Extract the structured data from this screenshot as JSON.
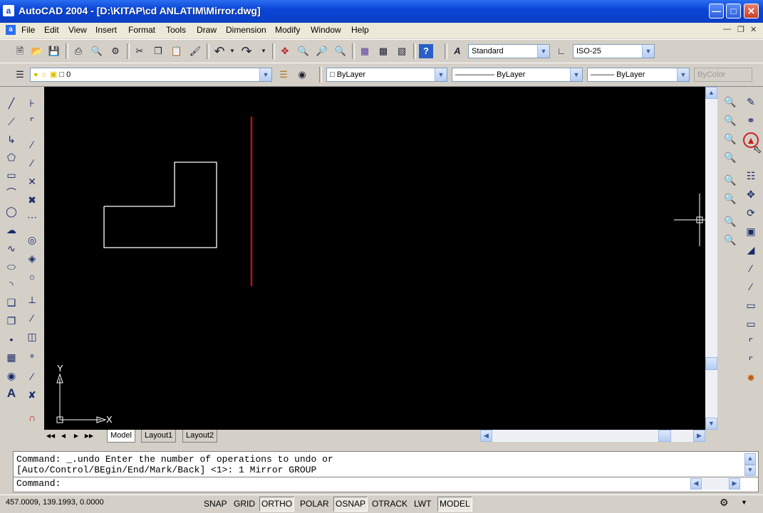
{
  "window": {
    "app_icon": "autocad-app-icon",
    "title": "AutoCAD 2004 - [D:\\KITAP\\cd ANLATIM\\Mirror.dwg]",
    "minimize_icon": "minimize-icon",
    "maximize_icon": "maximize-icon",
    "close_icon": "close-icon"
  },
  "menubar": {
    "items": [
      "File",
      "Edit",
      "View",
      "Insert",
      "Format",
      "Tools",
      "Draw",
      "Dimension",
      "Modify",
      "Window",
      "Help"
    ]
  },
  "standard_toolbar": {
    "text_style": "Standard",
    "dim_style": "ISO-25"
  },
  "layers_toolbar": {
    "layer": "0"
  },
  "properties_toolbar": {
    "color": "ByLayer",
    "linetype": "ByLayer",
    "lineweight": "ByLayer",
    "plotstyle": "ByColor"
  },
  "drawing": {
    "background": "#000000",
    "shape_color": "#ffffff",
    "mirror_line_color": "#aa1a10",
    "ucs_x_label": "X",
    "ucs_y_label": "Y"
  },
  "layout_tabs": {
    "items": [
      "Model",
      "Layout1",
      "Layout2"
    ],
    "active": "Model"
  },
  "command": {
    "history": [
      "Command: _.undo Enter the number of operations to undo or",
      "[Auto/Control/BEgin/End/Mark/Back] <1>: 1 Mirror GROUP"
    ],
    "prompt": "Command:"
  },
  "statusbar": {
    "coordinates": "457.0009, 139.1993, 0.0000",
    "toggles": [
      {
        "label": "SNAP",
        "on": false
      },
      {
        "label": "GRID",
        "on": false
      },
      {
        "label": "ORTHO",
        "on": true
      },
      {
        "label": "POLAR",
        "on": false
      },
      {
        "label": "OSNAP",
        "on": true
      },
      {
        "label": "OTRACK",
        "on": false
      },
      {
        "label": "LWT",
        "on": false
      },
      {
        "label": "MODEL",
        "on": true
      }
    ]
  }
}
